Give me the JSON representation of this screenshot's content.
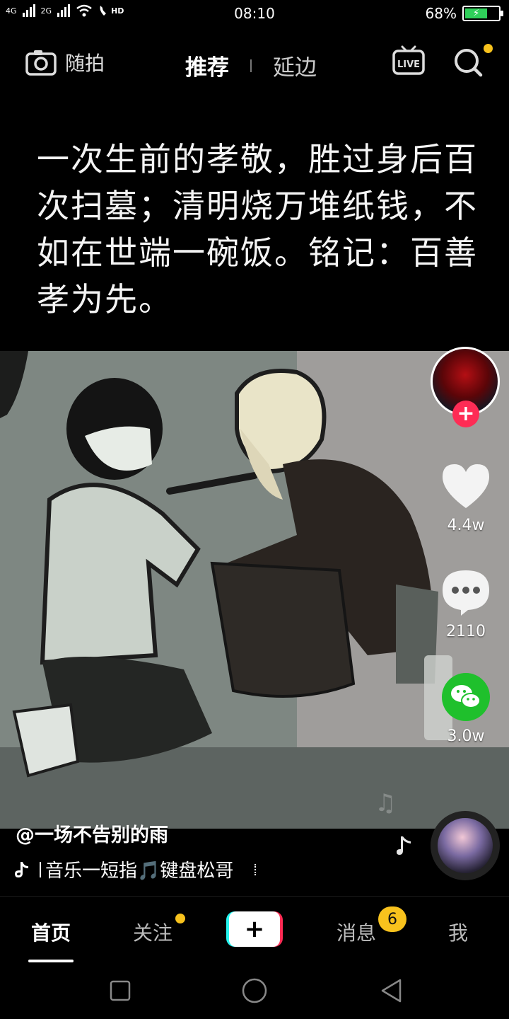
{
  "status_bar": {
    "network_1": "4G",
    "network_2": "2G",
    "hd_label": "HD",
    "time": "08:10",
    "battery_percent": "68%",
    "battery_level": 0.68
  },
  "top_nav": {
    "camera_label": "随拍",
    "tab_recommend": "推荐",
    "tab_local": "延边",
    "live_label": "LIVE"
  },
  "caption": {
    "text": "一次生前的孝敬，胜过身后百次扫墓；清明烧万堆纸钱，不如在世端一碗饭。铭记：百善孝为先。"
  },
  "rail": {
    "like_count": "4.4w",
    "comment_count": "2110",
    "share_count": "3.0w"
  },
  "info": {
    "author": "@一场不告别的雨",
    "music": "音乐一短指🎵键盘松哥"
  },
  "tabbar": {
    "home": "首页",
    "follow": "关注",
    "messages": "消息",
    "messages_badge": "6",
    "me": "我"
  },
  "colors": {
    "accent_pink": "#fe2c55",
    "accent_cyan": "#25f4ee",
    "badge_yellow": "#f8c21d",
    "wechat_green": "#1fc02c"
  }
}
